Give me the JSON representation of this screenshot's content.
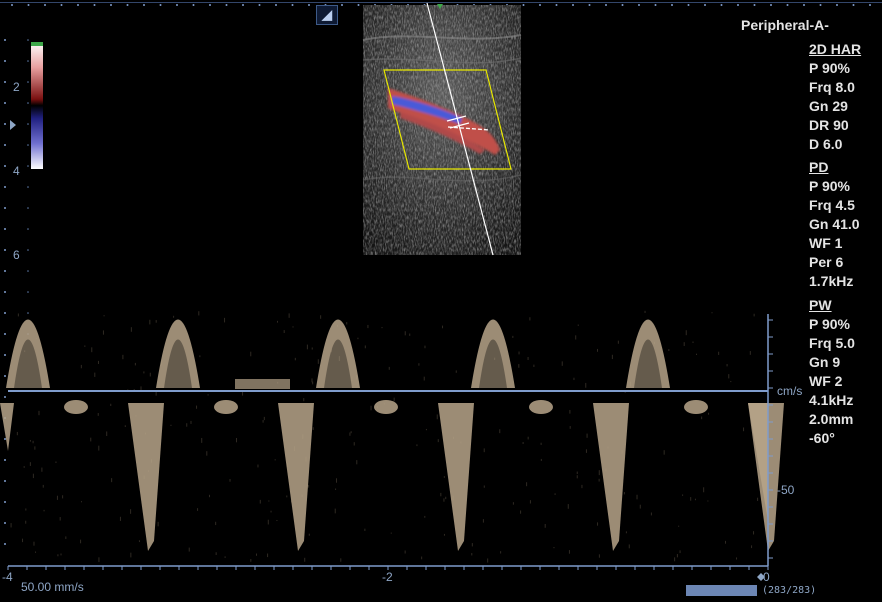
{
  "header": {
    "preset": "Peripheral-A-",
    "logo_icon": "logo-icon",
    "logo_glyph": "◢"
  },
  "color_scale": {
    "depth_marks": [
      "2",
      "4",
      "6"
    ]
  },
  "params": {
    "twod": {
      "title": "2D HAR",
      "lines": [
        "P 90%",
        "Frq 8.0",
        "Gn 29",
        "DR 90",
        "D 6.0"
      ]
    },
    "pd": {
      "title": "PD",
      "lines": [
        "P 90%",
        "Frq 4.5",
        "Gn 41.0",
        "WF 1",
        "Per 6",
        "1.7kHz"
      ]
    },
    "pw": {
      "title": "PW",
      "lines": [
        "P 90%",
        "Frq 5.0",
        "Gn 9",
        "WF 2",
        "4.1kHz",
        "2.0mm",
        "-60°"
      ]
    }
  },
  "doppler": {
    "unit": "cm/s",
    "scale_mark": "-50",
    "time_marks": [
      "-4",
      "-2",
      "0"
    ],
    "sweep_speed": "50.00 mm/s",
    "frame_counter": "(283/283)",
    "colors": {
      "spectrum": "#b7a489",
      "axis": "#7f9ccc"
    }
  }
}
